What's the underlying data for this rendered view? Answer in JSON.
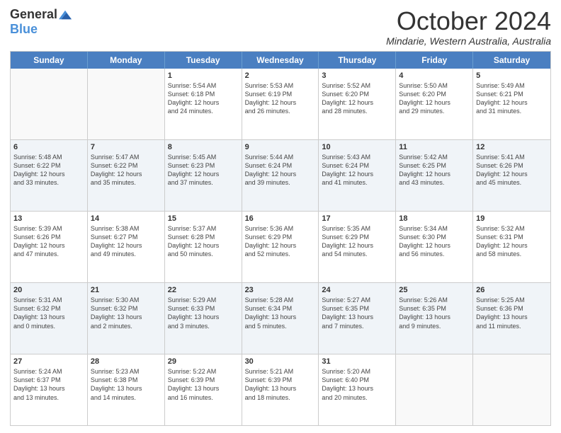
{
  "logo": {
    "general": "General",
    "blue": "Blue"
  },
  "title": "October 2024",
  "location": "Mindarie, Western Australia, Australia",
  "days_of_week": [
    "Sunday",
    "Monday",
    "Tuesday",
    "Wednesday",
    "Thursday",
    "Friday",
    "Saturday"
  ],
  "weeks": [
    [
      {
        "day": "",
        "info": ""
      },
      {
        "day": "",
        "info": ""
      },
      {
        "day": "1",
        "info": "Sunrise: 5:54 AM\nSunset: 6:18 PM\nDaylight: 12 hours\nand 24 minutes."
      },
      {
        "day": "2",
        "info": "Sunrise: 5:53 AM\nSunset: 6:19 PM\nDaylight: 12 hours\nand 26 minutes."
      },
      {
        "day": "3",
        "info": "Sunrise: 5:52 AM\nSunset: 6:20 PM\nDaylight: 12 hours\nand 28 minutes."
      },
      {
        "day": "4",
        "info": "Sunrise: 5:50 AM\nSunset: 6:20 PM\nDaylight: 12 hours\nand 29 minutes."
      },
      {
        "day": "5",
        "info": "Sunrise: 5:49 AM\nSunset: 6:21 PM\nDaylight: 12 hours\nand 31 minutes."
      }
    ],
    [
      {
        "day": "6",
        "info": "Sunrise: 5:48 AM\nSunset: 6:22 PM\nDaylight: 12 hours\nand 33 minutes."
      },
      {
        "day": "7",
        "info": "Sunrise: 5:47 AM\nSunset: 6:22 PM\nDaylight: 12 hours\nand 35 minutes."
      },
      {
        "day": "8",
        "info": "Sunrise: 5:45 AM\nSunset: 6:23 PM\nDaylight: 12 hours\nand 37 minutes."
      },
      {
        "day": "9",
        "info": "Sunrise: 5:44 AM\nSunset: 6:24 PM\nDaylight: 12 hours\nand 39 minutes."
      },
      {
        "day": "10",
        "info": "Sunrise: 5:43 AM\nSunset: 6:24 PM\nDaylight: 12 hours\nand 41 minutes."
      },
      {
        "day": "11",
        "info": "Sunrise: 5:42 AM\nSunset: 6:25 PM\nDaylight: 12 hours\nand 43 minutes."
      },
      {
        "day": "12",
        "info": "Sunrise: 5:41 AM\nSunset: 6:26 PM\nDaylight: 12 hours\nand 45 minutes."
      }
    ],
    [
      {
        "day": "13",
        "info": "Sunrise: 5:39 AM\nSunset: 6:26 PM\nDaylight: 12 hours\nand 47 minutes."
      },
      {
        "day": "14",
        "info": "Sunrise: 5:38 AM\nSunset: 6:27 PM\nDaylight: 12 hours\nand 49 minutes."
      },
      {
        "day": "15",
        "info": "Sunrise: 5:37 AM\nSunset: 6:28 PM\nDaylight: 12 hours\nand 50 minutes."
      },
      {
        "day": "16",
        "info": "Sunrise: 5:36 AM\nSunset: 6:29 PM\nDaylight: 12 hours\nand 52 minutes."
      },
      {
        "day": "17",
        "info": "Sunrise: 5:35 AM\nSunset: 6:29 PM\nDaylight: 12 hours\nand 54 minutes."
      },
      {
        "day": "18",
        "info": "Sunrise: 5:34 AM\nSunset: 6:30 PM\nDaylight: 12 hours\nand 56 minutes."
      },
      {
        "day": "19",
        "info": "Sunrise: 5:32 AM\nSunset: 6:31 PM\nDaylight: 12 hours\nand 58 minutes."
      }
    ],
    [
      {
        "day": "20",
        "info": "Sunrise: 5:31 AM\nSunset: 6:32 PM\nDaylight: 13 hours\nand 0 minutes."
      },
      {
        "day": "21",
        "info": "Sunrise: 5:30 AM\nSunset: 6:32 PM\nDaylight: 13 hours\nand 2 minutes."
      },
      {
        "day": "22",
        "info": "Sunrise: 5:29 AM\nSunset: 6:33 PM\nDaylight: 13 hours\nand 3 minutes."
      },
      {
        "day": "23",
        "info": "Sunrise: 5:28 AM\nSunset: 6:34 PM\nDaylight: 13 hours\nand 5 minutes."
      },
      {
        "day": "24",
        "info": "Sunrise: 5:27 AM\nSunset: 6:35 PM\nDaylight: 13 hours\nand 7 minutes."
      },
      {
        "day": "25",
        "info": "Sunrise: 5:26 AM\nSunset: 6:35 PM\nDaylight: 13 hours\nand 9 minutes."
      },
      {
        "day": "26",
        "info": "Sunrise: 5:25 AM\nSunset: 6:36 PM\nDaylight: 13 hours\nand 11 minutes."
      }
    ],
    [
      {
        "day": "27",
        "info": "Sunrise: 5:24 AM\nSunset: 6:37 PM\nDaylight: 13 hours\nand 13 minutes."
      },
      {
        "day": "28",
        "info": "Sunrise: 5:23 AM\nSunset: 6:38 PM\nDaylight: 13 hours\nand 14 minutes."
      },
      {
        "day": "29",
        "info": "Sunrise: 5:22 AM\nSunset: 6:39 PM\nDaylight: 13 hours\nand 16 minutes."
      },
      {
        "day": "30",
        "info": "Sunrise: 5:21 AM\nSunset: 6:39 PM\nDaylight: 13 hours\nand 18 minutes."
      },
      {
        "day": "31",
        "info": "Sunrise: 5:20 AM\nSunset: 6:40 PM\nDaylight: 13 hours\nand 20 minutes."
      },
      {
        "day": "",
        "info": ""
      },
      {
        "day": "",
        "info": ""
      }
    ]
  ]
}
